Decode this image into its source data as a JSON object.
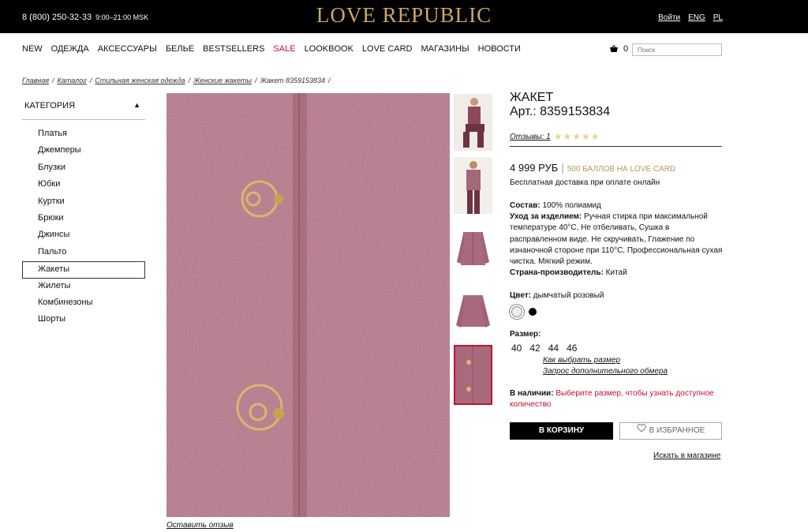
{
  "header": {
    "phone": "8 (800) 250-32-33",
    "hours": "9:00–21:00 MSK",
    "logo": "LOVE REPUBLIC",
    "login": "Войти",
    "lang_eng": "ENG",
    "lang_pl": "PL"
  },
  "nav": {
    "items": [
      "NEW",
      "ОДЕЖДА",
      "АКСЕССУАРЫ",
      "БЕЛЬЕ",
      "BESTSELLERS",
      "SALE",
      "LOOKBOOK",
      "LOVE CARD",
      "МАГАЗИНЫ",
      "НОВОСТИ"
    ],
    "cart_count": "0",
    "search_placeholder": "Поиск"
  },
  "breadcrumb": {
    "items": [
      "Главная",
      "Каталог",
      "Стильная женская одежда",
      "Женские жакеты"
    ],
    "current": "Жакет 8359153834",
    "sep": "/"
  },
  "sidebar": {
    "header": "КАТЕГОРИЯ",
    "toggle": "▲",
    "items": [
      "Платья",
      "Джемперы",
      "Блузки",
      "Юбки",
      "Куртки",
      "Брюки",
      "Джинсы",
      "Пальто",
      "Жакеты",
      "Жилеты",
      "Комбинезоны",
      "Шорты"
    ],
    "active_index": 8
  },
  "product": {
    "title": "ЖАКЕТ",
    "article": "Арт.: 8359153834",
    "reviews_label": "Отзывы: 1",
    "rating_stars": "★★★★★",
    "price": "4 999 РУБ",
    "price_sep": "|",
    "points": "500 БАЛЛОВ НА LOVE CARD",
    "delivery": "Бесплатная доставка при оплате онлайн",
    "composition_label": "Состав:",
    "composition": "100% полиамид",
    "care_label": "Уход за изделием:",
    "care": "Ручная стирка при максимальной температуре 40°С, Не отбеливать, Сушка в расправленном виде. Не скручивать, Глажение по изнаночной стороне при 110°С, Профессиональная сухая чистка. Мягкий режим.",
    "country_label": "Страна-производитель:",
    "country": "Китай",
    "color_label": "Цвет:",
    "color_value": "дымчатый розовый",
    "size_label": "Размер:",
    "sizes": [
      "40",
      "42",
      "44",
      "46"
    ],
    "size_guide": "Как выбрать размер",
    "size_request": "Запрос дополнительного обмера",
    "avail_label": "В наличии:",
    "avail_text": "Выберите размер, чтобы узнать доступное количество",
    "add_to_cart": "В КОРЗИНУ",
    "add_to_fav": "В ИЗБРАННОЕ",
    "find_in_store": "Искать в магазине",
    "leave_review": "Оставить отзыв"
  },
  "colors": {
    "accent_red": "#c8102e",
    "gold": "#c8a76a",
    "fabric": "#a86a7c",
    "swatch_pink": "#f2ecee",
    "swatch_black": "#000000"
  }
}
